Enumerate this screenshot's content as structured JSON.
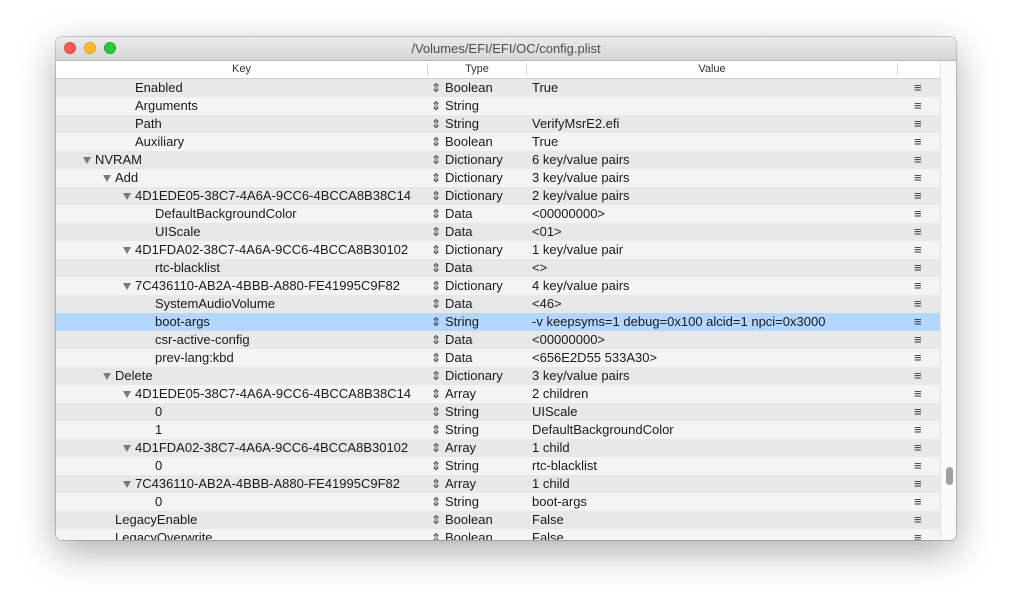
{
  "window": {
    "title": "/Volumes/EFI/EFI/OC/config.plist"
  },
  "columns": {
    "key": "Key",
    "type": "Type",
    "value": "Value"
  },
  "row_menu_glyph": "≡",
  "stepper_glyph": "⇕",
  "rows": [
    {
      "key": "Enabled",
      "type": "Boolean",
      "value": "True"
    },
    {
      "key": "Arguments",
      "type": "String",
      "value": ""
    },
    {
      "key": "Path",
      "type": "String",
      "value": "VerifyMsrE2.efi"
    },
    {
      "key": "Auxiliary",
      "type": "Boolean",
      "value": "True"
    },
    {
      "key": "NVRAM",
      "type": "Dictionary",
      "value": "6 key/value pairs",
      "expanded": true
    },
    {
      "key": "Add",
      "type": "Dictionary",
      "value": "3 key/value pairs",
      "expanded": true
    },
    {
      "key": "4D1EDE05-38C7-4A6A-9CC6-4BCCA8B38C14",
      "type": "Dictionary",
      "value": "2 key/value pairs",
      "expanded": true
    },
    {
      "key": "DefaultBackgroundColor",
      "type": "Data",
      "value": "<00000000>"
    },
    {
      "key": "UIScale",
      "type": "Data",
      "value": "<01>"
    },
    {
      "key": "4D1FDA02-38C7-4A6A-9CC6-4BCCA8B30102",
      "type": "Dictionary",
      "value": "1 key/value pair",
      "expanded": true
    },
    {
      "key": "rtc-blacklist",
      "type": "Data",
      "value": "<>"
    },
    {
      "key": "7C436110-AB2A-4BBB-A880-FE41995C9F82",
      "type": "Dictionary",
      "value": "4 key/value pairs",
      "expanded": true
    },
    {
      "key": "SystemAudioVolume",
      "type": "Data",
      "value": "<46>"
    },
    {
      "key": "boot-args",
      "type": "String",
      "value": "-v keepsyms=1 debug=0x100 alcid=1 npci=0x3000",
      "selected": true
    },
    {
      "key": "csr-active-config",
      "type": "Data",
      "value": "<00000000>"
    },
    {
      "key": "prev-lang:kbd",
      "type": "Data",
      "value": "<656E2D55 533A30>"
    },
    {
      "key": "Delete",
      "type": "Dictionary",
      "value": "3 key/value pairs",
      "expanded": true
    },
    {
      "key": "4D1EDE05-38C7-4A6A-9CC6-4BCCA8B38C14",
      "type": "Array",
      "value": "2 children",
      "expanded": true
    },
    {
      "key": "0",
      "type": "String",
      "value": "UIScale"
    },
    {
      "key": "1",
      "type": "String",
      "value": "DefaultBackgroundColor"
    },
    {
      "key": "4D1FDA02-38C7-4A6A-9CC6-4BCCA8B30102",
      "type": "Array",
      "value": "1 child",
      "expanded": true
    },
    {
      "key": "0",
      "type": "String",
      "value": "rtc-blacklist"
    },
    {
      "key": "7C436110-AB2A-4BBB-A880-FE41995C9F82",
      "type": "Array",
      "value": "1 child",
      "expanded": true
    },
    {
      "key": "0",
      "type": "String",
      "value": "boot-args"
    },
    {
      "key": "LegacyEnable",
      "type": "Boolean",
      "value": "False"
    },
    {
      "key": "LegacyOverwrite",
      "type": "Boolean",
      "value": "False"
    }
  ]
}
